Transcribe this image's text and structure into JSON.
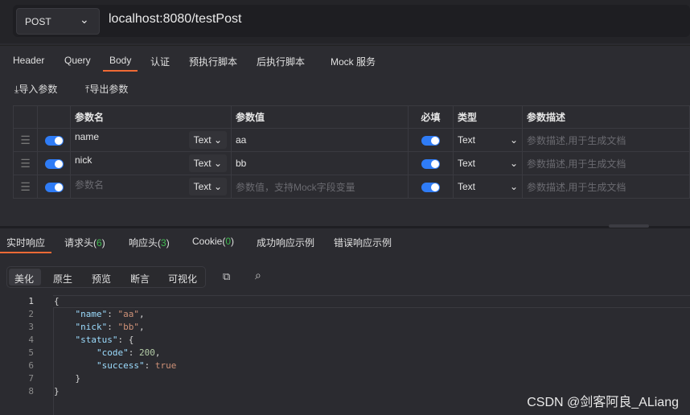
{
  "request": {
    "method": "POST",
    "url": "localhost:8080/testPost"
  },
  "tabs": [
    "Header",
    "Query",
    "Body",
    "认证",
    "预执行脚本",
    "后执行脚本",
    "Mock 服务"
  ],
  "actions": {
    "import": "导入参数",
    "export": "导出参数"
  },
  "table": {
    "headers": [
      "参数名",
      "参数值",
      "必填",
      "类型",
      "参数描述"
    ],
    "rows": [
      {
        "name": "name",
        "kind": "Text",
        "value": "aa",
        "type": "Text",
        "desc": "参数描述,用于生成文档"
      },
      {
        "name": "nick",
        "kind": "Text",
        "value": "bb",
        "type": "Text",
        "desc": "参数描述,用于生成文档"
      }
    ],
    "new_row": {
      "name_placeholder": "参数名",
      "kind": "Text",
      "value_placeholder": "参数值，支持Mock字段变量",
      "type": "Text",
      "desc": "参数描述,用于生成文档"
    }
  },
  "response_tabs": {
    "realtime": "实时响应",
    "req_headers": "请求头(",
    "req_count": "6",
    "resp_headers": "响应头(",
    "resp_count": "3",
    "cookie": "Cookie(",
    "cookie_count": "0",
    "close": ")",
    "success": "成功响应示例",
    "error": "错误响应示例"
  },
  "view_modes": [
    "美化",
    "原生",
    "预览",
    "断言",
    "可视化"
  ],
  "code_lines": [
    [
      [
        "",
        "{"
      ]
    ],
    [
      [
        "k",
        "    \"name\""
      ],
      [
        "",
        ": "
      ],
      [
        "s",
        "\"aa\""
      ],
      [
        "",
        ","
      ]
    ],
    [
      [
        "k",
        "    \"nick\""
      ],
      [
        "",
        ": "
      ],
      [
        "s",
        "\"bb\""
      ],
      [
        "",
        ","
      ]
    ],
    [
      [
        "k",
        "    \"status\""
      ],
      [
        "",
        ": {"
      ]
    ],
    [
      [
        "k",
        "        \"code\""
      ],
      [
        "",
        ": "
      ],
      [
        "n",
        "200"
      ],
      [
        "",
        ","
      ]
    ],
    [
      [
        "k",
        "        \"success\""
      ],
      [
        "",
        ": "
      ],
      [
        "s",
        "true"
      ]
    ],
    [
      [
        "",
        "    }"
      ]
    ],
    [
      [
        "",
        "}"
      ]
    ]
  ],
  "watermark": "CSDN @剑客阿良_ALiang"
}
